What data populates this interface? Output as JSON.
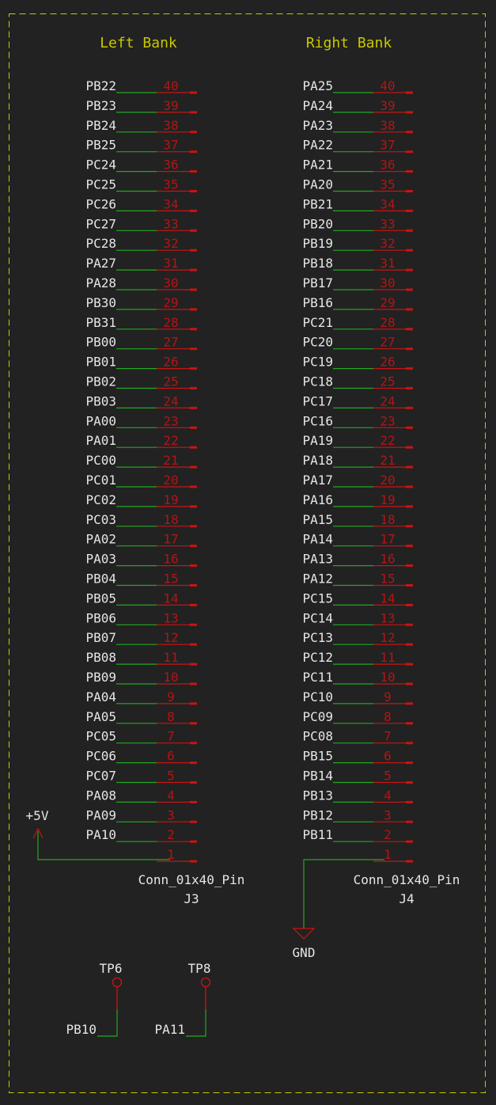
{
  "colors": {
    "background": "#222222",
    "frame": "#c8c800",
    "title": "#c8c800",
    "wire": "#22a822",
    "pin": "#c81414",
    "pin_number": "#b41414",
    "label": "#e6e6e6"
  },
  "sections": {
    "left_title": "Left Bank",
    "right_title": "Right Bank"
  },
  "left_connector": {
    "name": "Conn_01x40_Pin",
    "ref": "J3",
    "pins": [
      {
        "num": "40",
        "net": "PB22"
      },
      {
        "num": "39",
        "net": "PB23"
      },
      {
        "num": "38",
        "net": "PB24"
      },
      {
        "num": "37",
        "net": "PB25"
      },
      {
        "num": "36",
        "net": "PC24"
      },
      {
        "num": "35",
        "net": "PC25"
      },
      {
        "num": "34",
        "net": "PC26"
      },
      {
        "num": "33",
        "net": "PC27"
      },
      {
        "num": "32",
        "net": "PC28"
      },
      {
        "num": "31",
        "net": "PA27"
      },
      {
        "num": "30",
        "net": "PA28"
      },
      {
        "num": "29",
        "net": "PB30"
      },
      {
        "num": "28",
        "net": "PB31"
      },
      {
        "num": "27",
        "net": "PB00"
      },
      {
        "num": "26",
        "net": "PB01"
      },
      {
        "num": "25",
        "net": "PB02"
      },
      {
        "num": "24",
        "net": "PB03"
      },
      {
        "num": "23",
        "net": "PA00"
      },
      {
        "num": "22",
        "net": "PA01"
      },
      {
        "num": "21",
        "net": "PC00"
      },
      {
        "num": "20",
        "net": "PC01"
      },
      {
        "num": "19",
        "net": "PC02"
      },
      {
        "num": "18",
        "net": "PC03"
      },
      {
        "num": "17",
        "net": "PA02"
      },
      {
        "num": "16",
        "net": "PA03"
      },
      {
        "num": "15",
        "net": "PB04"
      },
      {
        "num": "14",
        "net": "PB05"
      },
      {
        "num": "13",
        "net": "PB06"
      },
      {
        "num": "12",
        "net": "PB07"
      },
      {
        "num": "11",
        "net": "PB08"
      },
      {
        "num": "10",
        "net": "PB09"
      },
      {
        "num": "9",
        "net": "PA04"
      },
      {
        "num": "8",
        "net": "PA05"
      },
      {
        "num": "7",
        "net": "PC05"
      },
      {
        "num": "6",
        "net": "PC06"
      },
      {
        "num": "5",
        "net": "PC07"
      },
      {
        "num": "4",
        "net": "PA08"
      },
      {
        "num": "3",
        "net": "PA09"
      },
      {
        "num": "2",
        "net": "PA10"
      },
      {
        "num": "1",
        "net": ""
      }
    ]
  },
  "right_connector": {
    "name": "Conn_01x40_Pin",
    "ref": "J4",
    "pins": [
      {
        "num": "40",
        "net": "PA25"
      },
      {
        "num": "39",
        "net": "PA24"
      },
      {
        "num": "38",
        "net": "PA23"
      },
      {
        "num": "37",
        "net": "PA22"
      },
      {
        "num": "36",
        "net": "PA21"
      },
      {
        "num": "35",
        "net": "PA20"
      },
      {
        "num": "34",
        "net": "PB21"
      },
      {
        "num": "33",
        "net": "PB20"
      },
      {
        "num": "32",
        "net": "PB19"
      },
      {
        "num": "31",
        "net": "PB18"
      },
      {
        "num": "30",
        "net": "PB17"
      },
      {
        "num": "29",
        "net": "PB16"
      },
      {
        "num": "28",
        "net": "PC21"
      },
      {
        "num": "27",
        "net": "PC20"
      },
      {
        "num": "26",
        "net": "PC19"
      },
      {
        "num": "25",
        "net": "PC18"
      },
      {
        "num": "24",
        "net": "PC17"
      },
      {
        "num": "23",
        "net": "PC16"
      },
      {
        "num": "22",
        "net": "PA19"
      },
      {
        "num": "21",
        "net": "PA18"
      },
      {
        "num": "20",
        "net": "PA17"
      },
      {
        "num": "19",
        "net": "PA16"
      },
      {
        "num": "18",
        "net": "PA15"
      },
      {
        "num": "17",
        "net": "PA14"
      },
      {
        "num": "16",
        "net": "PA13"
      },
      {
        "num": "15",
        "net": "PA12"
      },
      {
        "num": "14",
        "net": "PC15"
      },
      {
        "num": "13",
        "net": "PC14"
      },
      {
        "num": "12",
        "net": "PC13"
      },
      {
        "num": "11",
        "net": "PC12"
      },
      {
        "num": "10",
        "net": "PC11"
      },
      {
        "num": "9",
        "net": "PC10"
      },
      {
        "num": "8",
        "net": "PC09"
      },
      {
        "num": "7",
        "net": "PC08"
      },
      {
        "num": "6",
        "net": "PB15"
      },
      {
        "num": "5",
        "net": "PB14"
      },
      {
        "num": "4",
        "net": "PB13"
      },
      {
        "num": "3",
        "net": "PB12"
      },
      {
        "num": "2",
        "net": "PB11"
      },
      {
        "num": "1",
        "net": ""
      }
    ]
  },
  "power": {
    "vcc_label": "+5V",
    "gnd_label": "GND"
  },
  "test_points": [
    {
      "ref": "TP6",
      "net": "PB10"
    },
    {
      "ref": "TP8",
      "net": "PA11"
    }
  ]
}
